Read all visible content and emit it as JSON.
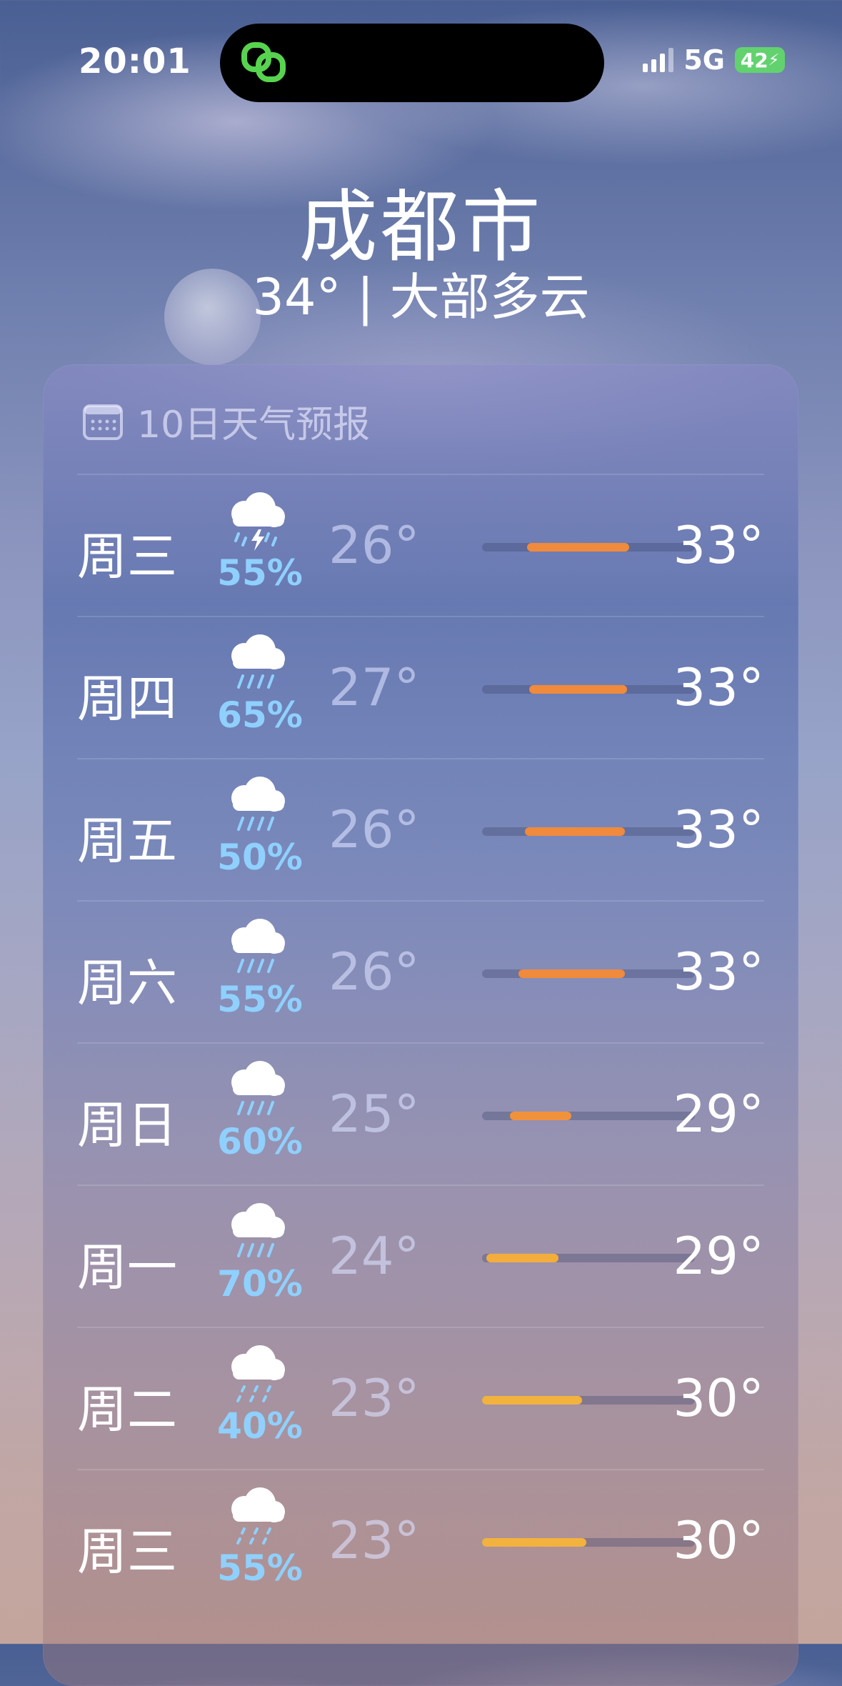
{
  "status": {
    "time": "20:01",
    "network": "5G",
    "battery": "42"
  },
  "header": {
    "city": "成都市",
    "summary": "34° | 大部多云"
  },
  "forecast": {
    "title": "10日天气预报",
    "days": [
      {
        "day": "周三",
        "icon": "thunderstorm-icon",
        "precip": "55%",
        "low": "26°",
        "high": "33°",
        "bar_start": 0.21,
        "bar_end": 0.69,
        "bar_color": "#f08a3c"
      },
      {
        "day": "周四",
        "icon": "rain-icon",
        "precip": "65%",
        "low": "27°",
        "high": "33°",
        "bar_start": 0.22,
        "bar_end": 0.68,
        "bar_color": "#f08a3c"
      },
      {
        "day": "周五",
        "icon": "rain-icon",
        "precip": "50%",
        "low": "26°",
        "high": "33°",
        "bar_start": 0.2,
        "bar_end": 0.67,
        "bar_color": "#f08a3c"
      },
      {
        "day": "周六",
        "icon": "rain-icon",
        "precip": "55%",
        "low": "26°",
        "high": "33°",
        "bar_start": 0.17,
        "bar_end": 0.67,
        "bar_color": "#f08a3c"
      },
      {
        "day": "周日",
        "icon": "rain-icon",
        "precip": "60%",
        "low": "25°",
        "high": "29°",
        "bar_start": 0.13,
        "bar_end": 0.42,
        "bar_color": "#f0923c"
      },
      {
        "day": "周一",
        "icon": "rain-icon",
        "precip": "70%",
        "low": "24°",
        "high": "29°",
        "bar_start": 0.02,
        "bar_end": 0.36,
        "bar_color": "#f2ad3d"
      },
      {
        "day": "周二",
        "icon": "drizzle-icon",
        "precip": "40%",
        "low": "23°",
        "high": "30°",
        "bar_start": 0.0,
        "bar_end": 0.47,
        "bar_color": "#f2b23e"
      },
      {
        "day": "周三",
        "icon": "drizzle-icon",
        "precip": "55%",
        "low": "23°",
        "high": "30°",
        "bar_start": 0.0,
        "bar_end": 0.49,
        "bar_color": "#f2b23e"
      }
    ]
  }
}
